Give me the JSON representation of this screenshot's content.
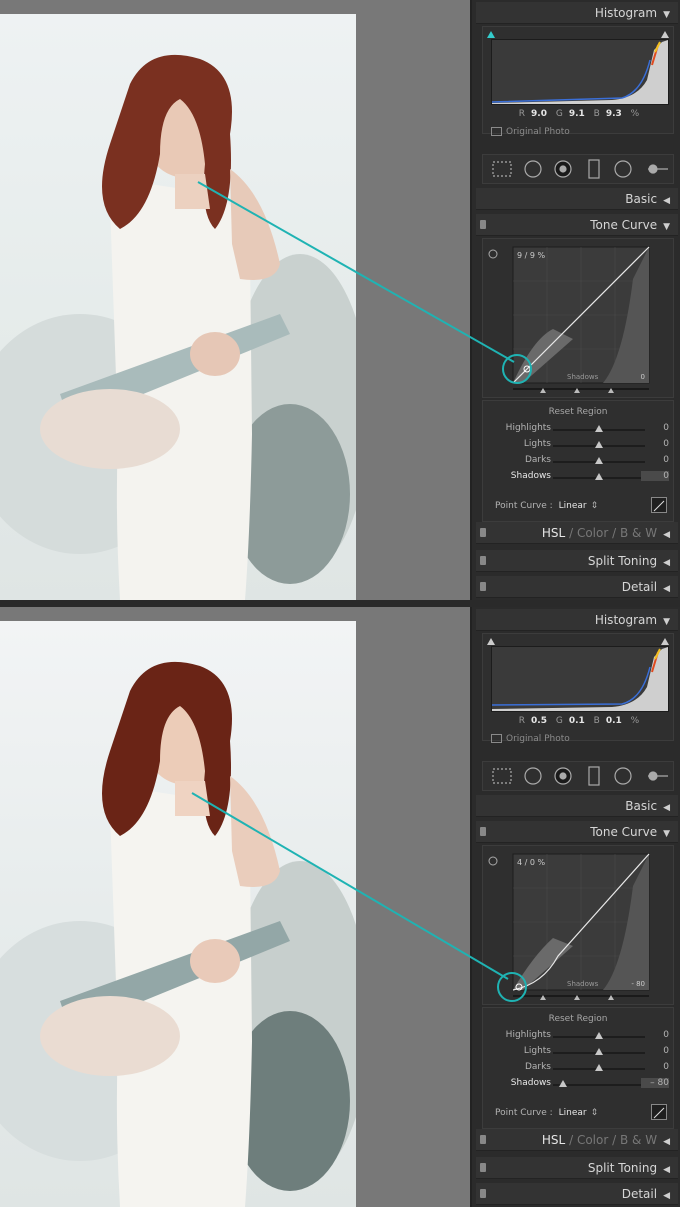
{
  "panels": [
    {
      "histogram": {
        "title": "Histogram",
        "r_label": "R",
        "r_value": "9.0",
        "g_label": "G",
        "g_value": "9.1",
        "b_label": "B",
        "b_value": "9.3",
        "unit": "%",
        "original_photo": "Original Photo"
      },
      "basic": "Basic",
      "tone_curve": {
        "title": "Tone Curve",
        "readout": "9 / 9 %",
        "region": "Shadows",
        "region_value": "0",
        "reset_region": "Reset Region",
        "sliders": [
          {
            "label": "Highlights",
            "value": "0",
            "level": 0.5
          },
          {
            "label": "Lights",
            "value": "0",
            "level": 0.5
          },
          {
            "label": "Darks",
            "value": "0",
            "level": 0.5
          },
          {
            "label": "Shadows",
            "value": "0",
            "level": 0.5
          }
        ],
        "point_curve_label": "Point Curve :",
        "point_curve_value": "Linear"
      },
      "hsl": {
        "hsl": "HSL",
        "color": "Color",
        "bw": "B & W",
        "sep": "/"
      },
      "split_toning": "Split Toning",
      "detail": "Detail"
    },
    {
      "histogram": {
        "title": "Histogram",
        "r_label": "R",
        "r_value": "0.5",
        "g_label": "G",
        "g_value": "0.1",
        "b_label": "B",
        "b_value": "0.1",
        "unit": "%",
        "original_photo": "Original Photo"
      },
      "basic": "Basic",
      "tone_curve": {
        "title": "Tone Curve",
        "readout": "4 / 0 %",
        "region": "Shadows",
        "region_value": "- 80",
        "reset_region": "Reset Region",
        "sliders": [
          {
            "label": "Highlights",
            "value": "0",
            "level": 0.5
          },
          {
            "label": "Lights",
            "value": "0",
            "level": 0.5
          },
          {
            "label": "Darks",
            "value": "0",
            "level": 0.5
          },
          {
            "label": "Shadows",
            "value": "– 80",
            "level": 0.1
          }
        ],
        "point_curve_label": "Point Curve :",
        "point_curve_value": "Linear"
      },
      "hsl": {
        "hsl": "HSL",
        "color": "Color",
        "bw": "B & W",
        "sep": "/"
      },
      "split_toning": "Split Toning",
      "detail": "Detail"
    }
  ],
  "colors": {
    "callout": "#1fb3b3",
    "panel_bg": "#2b2b2b",
    "header_bg": "#333333"
  }
}
